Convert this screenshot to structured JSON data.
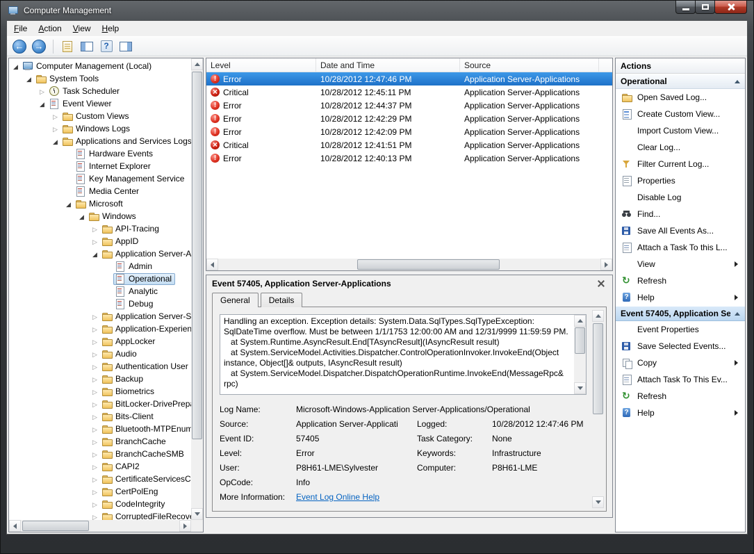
{
  "window": {
    "title": "Computer Management"
  },
  "colors": {
    "selection_blue": "#2f80d2",
    "error_red": "#cc2012",
    "link_blue": "#0563c1",
    "folder_yellow": "#f0c35c"
  },
  "menu": {
    "items": [
      {
        "label": "File",
        "accel": "F"
      },
      {
        "label": "Action",
        "accel": "A"
      },
      {
        "label": "View",
        "accel": "V"
      },
      {
        "label": "Help",
        "accel": "H"
      }
    ]
  },
  "toolbar": {
    "buttons": [
      {
        "name": "back",
        "icon": "arrow-left"
      },
      {
        "name": "forward",
        "icon": "arrow-right"
      },
      {
        "name": "separator",
        "icon": "separator"
      },
      {
        "name": "export-list",
        "icon": "doc"
      },
      {
        "name": "show-hide-console-tree",
        "icon": "window-left"
      },
      {
        "name": "help",
        "icon": "help"
      },
      {
        "name": "show-hide-action-pane",
        "icon": "window-right"
      }
    ]
  },
  "tree": {
    "items": [
      {
        "label": "Computer Management (Local)",
        "depth": 0,
        "expander": "expanded",
        "icon": "computer"
      },
      {
        "label": "System Tools",
        "depth": 1,
        "expander": "expanded",
        "icon": "tools"
      },
      {
        "label": "Task Scheduler",
        "depth": 2,
        "expander": "collapsed",
        "icon": "clock"
      },
      {
        "label": "Event Viewer",
        "depth": 2,
        "expander": "expanded",
        "icon": "eventvwr"
      },
      {
        "label": "Custom Views",
        "depth": 3,
        "expander": "collapsed",
        "icon": "folder"
      },
      {
        "label": "Windows Logs",
        "depth": 3,
        "expander": "collapsed",
        "icon": "folder"
      },
      {
        "label": "Applications and Services Logs",
        "depth": 3,
        "expander": "expanded",
        "icon": "folder"
      },
      {
        "label": "Hardware Events",
        "depth": 4,
        "expander": "none",
        "icon": "log"
      },
      {
        "label": "Internet Explorer",
        "depth": 4,
        "expander": "none",
        "icon": "log"
      },
      {
        "label": "Key Management Service",
        "depth": 4,
        "expander": "none",
        "icon": "log"
      },
      {
        "label": "Media Center",
        "depth": 4,
        "expander": "none",
        "icon": "log"
      },
      {
        "label": "Microsoft",
        "depth": 4,
        "expander": "expanded",
        "icon": "folder"
      },
      {
        "label": "Windows",
        "depth": 5,
        "expander": "expanded",
        "icon": "folder"
      },
      {
        "label": "API-Tracing",
        "depth": 6,
        "expander": "collapsed",
        "icon": "folder"
      },
      {
        "label": "AppID",
        "depth": 6,
        "expander": "collapsed",
        "icon": "folder"
      },
      {
        "label": "Application Server-Appl",
        "depth": 6,
        "expander": "expanded",
        "icon": "folder"
      },
      {
        "label": "Admin",
        "depth": 7,
        "expander": "none",
        "icon": "log"
      },
      {
        "label": "Operational",
        "depth": 7,
        "expander": "none",
        "icon": "log",
        "selected": true
      },
      {
        "label": "Analytic",
        "depth": 7,
        "expander": "none",
        "icon": "log"
      },
      {
        "label": "Debug",
        "depth": 7,
        "expander": "none",
        "icon": "log"
      },
      {
        "label": "Application Server-Syste",
        "depth": 6,
        "expander": "collapsed",
        "icon": "folder"
      },
      {
        "label": "Application-Experience",
        "depth": 6,
        "expander": "collapsed",
        "icon": "folder"
      },
      {
        "label": "AppLocker",
        "depth": 6,
        "expander": "collapsed",
        "icon": "folder"
      },
      {
        "label": "Audio",
        "depth": 6,
        "expander": "collapsed",
        "icon": "folder"
      },
      {
        "label": "Authentication User Inte",
        "depth": 6,
        "expander": "collapsed",
        "icon": "folder"
      },
      {
        "label": "Backup",
        "depth": 6,
        "expander": "collapsed",
        "icon": "folder"
      },
      {
        "label": "Biometrics",
        "depth": 6,
        "expander": "collapsed",
        "icon": "folder"
      },
      {
        "label": "BitLocker-DrivePreparat",
        "depth": 6,
        "expander": "collapsed",
        "icon": "folder"
      },
      {
        "label": "Bits-Client",
        "depth": 6,
        "expander": "collapsed",
        "icon": "folder"
      },
      {
        "label": "Bluetooth-MTPEnum",
        "depth": 6,
        "expander": "collapsed",
        "icon": "folder"
      },
      {
        "label": "BranchCache",
        "depth": 6,
        "expander": "collapsed",
        "icon": "folder"
      },
      {
        "label": "BranchCacheSMB",
        "depth": 6,
        "expander": "collapsed",
        "icon": "folder"
      },
      {
        "label": "CAPI2",
        "depth": 6,
        "expander": "collapsed",
        "icon": "folder"
      },
      {
        "label": "CertificateServicesClient",
        "depth": 6,
        "expander": "collapsed",
        "icon": "folder"
      },
      {
        "label": "CertPolEng",
        "depth": 6,
        "expander": "collapsed",
        "icon": "folder"
      },
      {
        "label": "CodeIntegrity",
        "depth": 6,
        "expander": "collapsed",
        "icon": "folder"
      },
      {
        "label": "CorruptedFileRecovery-",
        "depth": 6,
        "expander": "collapsed",
        "icon": "folder"
      }
    ]
  },
  "event_list": {
    "columns": [
      "Level",
      "Date and Time",
      "Source"
    ],
    "rows": [
      {
        "level": "Error",
        "icon": "error",
        "datetime": "10/28/2012 12:47:46 PM",
        "source": "Application Server-Applications",
        "selected": true
      },
      {
        "level": "Critical",
        "icon": "critical",
        "datetime": "10/28/2012 12:45:11 PM",
        "source": "Application Server-Applications"
      },
      {
        "level": "Error",
        "icon": "error",
        "datetime": "10/28/2012 12:44:37 PM",
        "source": "Application Server-Applications"
      },
      {
        "level": "Error",
        "icon": "error",
        "datetime": "10/28/2012 12:42:29 PM",
        "source": "Application Server-Applications"
      },
      {
        "level": "Error",
        "icon": "error",
        "datetime": "10/28/2012 12:42:09 PM",
        "source": "Application Server-Applications"
      },
      {
        "level": "Critical",
        "icon": "critical",
        "datetime": "10/28/2012 12:41:51 PM",
        "source": "Application Server-Applications"
      },
      {
        "level": "Error",
        "icon": "error",
        "datetime": "10/28/2012 12:40:13 PM",
        "source": "Application Server-Applications"
      }
    ]
  },
  "detail": {
    "title": "Event 57405, Application Server-Applications",
    "tabs": [
      {
        "label": "General",
        "active": true
      },
      {
        "label": "Details",
        "active": false
      }
    ],
    "description": "Handling an exception. Exception details: System.Data.SqlTypes.SqlTypeException:\nSqlDateTime overflow. Must be between 1/1/1753 12:00:00 AM and 12/31/9999 11:59:59 PM.\n   at System.Runtime.AsyncResult.End[TAsyncResult](IAsyncResult result)\n   at System.ServiceModel.Activities.Dispatcher.ControlOperationInvoker.InvokeEnd(Object\ninstance, Object[]& outputs, IAsyncResult result)\n   at System.ServiceModel.Dispatcher.DispatchOperationRuntime.InvokeEnd(MessageRpc&\nrpc)",
    "fields": [
      {
        "label": "Log Name:",
        "value": "Microsoft-Windows-Application Server-Applications/Operational",
        "span": true
      },
      {
        "label": "Source:",
        "value": "Application Server-Applicati",
        "label2": "Logged:",
        "value2": "10/28/2012 12:47:46 PM"
      },
      {
        "label": "Event ID:",
        "value": "57405",
        "label2": "Task Category:",
        "value2": "None"
      },
      {
        "label": "Level:",
        "value": "Error",
        "label2": "Keywords:",
        "value2": "Infrastructure"
      },
      {
        "label": "User:",
        "value": "P8H61-LME\\Sylvester",
        "label2": "Computer:",
        "value2": "P8H61-LME"
      },
      {
        "label": "OpCode:",
        "value": "Info"
      },
      {
        "label": "More Information:",
        "value": "Event Log Online Help",
        "link": true
      }
    ]
  },
  "actions": {
    "title": "Actions",
    "sections": [
      {
        "title": "Operational",
        "selected": false,
        "items": [
          {
            "label": "Open Saved Log...",
            "icon": "folder-open"
          },
          {
            "label": "Create Custom View...",
            "icon": "custom-view"
          },
          {
            "label": "Import Custom View...",
            "icon": "none"
          },
          {
            "label": "Clear Log...",
            "icon": "none"
          },
          {
            "label": "Filter Current Log...",
            "icon": "filter"
          },
          {
            "label": "Properties",
            "icon": "properties"
          },
          {
            "label": "Disable Log",
            "icon": "none"
          },
          {
            "label": "Find...",
            "icon": "find"
          },
          {
            "label": "Save All Events As...",
            "icon": "save"
          },
          {
            "label": "Attach a Task To this L...",
            "icon": "task"
          },
          {
            "label": "View",
            "icon": "none",
            "submenu": true
          },
          {
            "label": "Refresh",
            "icon": "refresh"
          },
          {
            "label": "Help",
            "icon": "help",
            "submenu": true
          }
        ]
      },
      {
        "title": "Event 57405, Application Se...",
        "selected": true,
        "items": [
          {
            "label": "Event Properties",
            "icon": "none"
          },
          {
            "label": "Save Selected Events...",
            "icon": "save"
          },
          {
            "label": "Copy",
            "icon": "copy",
            "submenu": true
          },
          {
            "label": "Attach Task To This Ev...",
            "icon": "task"
          },
          {
            "label": "Refresh",
            "icon": "refresh"
          },
          {
            "label": "Help",
            "icon": "help",
            "submenu": true
          }
        ]
      }
    ]
  }
}
